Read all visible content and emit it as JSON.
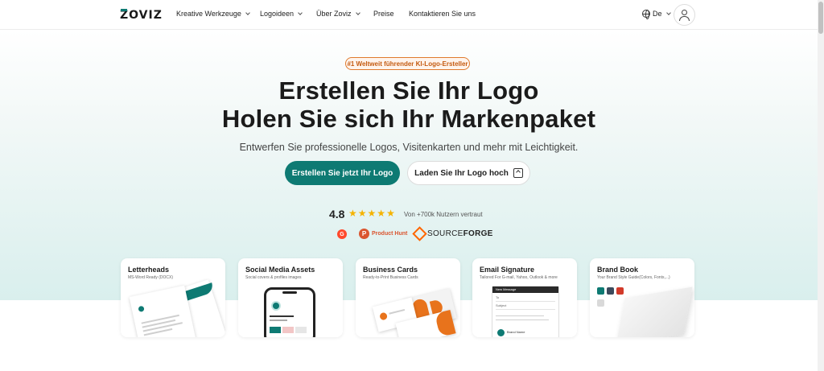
{
  "nav": {
    "logo": "ZOVIZ",
    "items": [
      {
        "label": "Kreative Werkzeuge",
        "dropdown": true
      },
      {
        "label": "Logoideen",
        "dropdown": true
      },
      {
        "label": "Über Zoviz",
        "dropdown": true
      },
      {
        "label": "Preise",
        "dropdown": false
      },
      {
        "label": "Kontaktieren Sie uns",
        "dropdown": false
      }
    ],
    "language": "De"
  },
  "hero": {
    "badge": "#1 Weltweit führender KI-Logo-Ersteller",
    "title_line1": "Erstellen Sie Ihr Logo",
    "title_line2": "Holen Sie sich Ihr Markenpaket",
    "subtitle": "Entwerfen Sie professionelle Logos, Visitenkarten und mehr mit Leichtigkeit.",
    "primary_button": "Erstellen Sie jetzt Ihr Logo",
    "secondary_button": "Laden Sie Ihr Logo hoch",
    "rating": "4.8",
    "stars": 5,
    "trust_text": "Von +700k Nutzern vertraut",
    "badges": {
      "g2": "G",
      "product_hunt_icon": "P",
      "product_hunt": "Product Hunt",
      "sourceforge_a": "SOURCE",
      "sourceforge_b": "FORGE"
    }
  },
  "cards": [
    {
      "title": "Letterheads",
      "subtitle": "MS-Word Ready (DOCX)"
    },
    {
      "title": "Social Media Assets",
      "subtitle": "Social covers & profiles images"
    },
    {
      "title": "Business Cards",
      "subtitle": "Ready-to-Print Business Cards"
    },
    {
      "title": "Email Signature",
      "subtitle": "Tailored For G-mail, Yahoo, Outlook & more"
    },
    {
      "title": "Brand Book",
      "subtitle": "Your Brand Style Guide(Colors, Fonts,...)"
    }
  ],
  "card_art": {
    "email_new_message": "New Message",
    "email_to": "To",
    "email_subject": "Subject",
    "email_name": "Brand Name"
  },
  "colors": {
    "brand": "#0e7a73",
    "accent_orange": "#e8731c",
    "star": "#f5b301"
  },
  "icons": [
    "chevron-down-icon",
    "globe-icon",
    "user-icon",
    "upload-icon",
    "star-icon"
  ]
}
